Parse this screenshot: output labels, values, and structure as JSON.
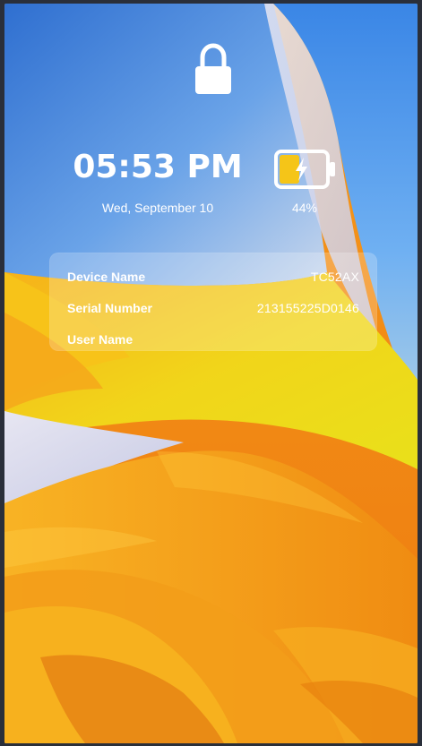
{
  "lockscreen": {
    "time": "05:53 PM",
    "date": "Wed, September 10",
    "battery_percent": "44%",
    "battery_level": 0.44,
    "battery_charging": true
  },
  "device_info": {
    "rows": [
      {
        "label": "Device Name",
        "value": "TC52AX"
      },
      {
        "label": "Serial Number",
        "value": "213155225D0146"
      },
      {
        "label": "User Name",
        "value": ""
      }
    ]
  },
  "icons": {
    "lock": "lock-icon",
    "battery": "battery-charging-icon"
  },
  "colors": {
    "battery_fill": "#F5C518",
    "wallpaper_blue": "#3F7FD8",
    "wallpaper_yellow": "#F2D51C",
    "wallpaper_orange": "#F08A12"
  }
}
